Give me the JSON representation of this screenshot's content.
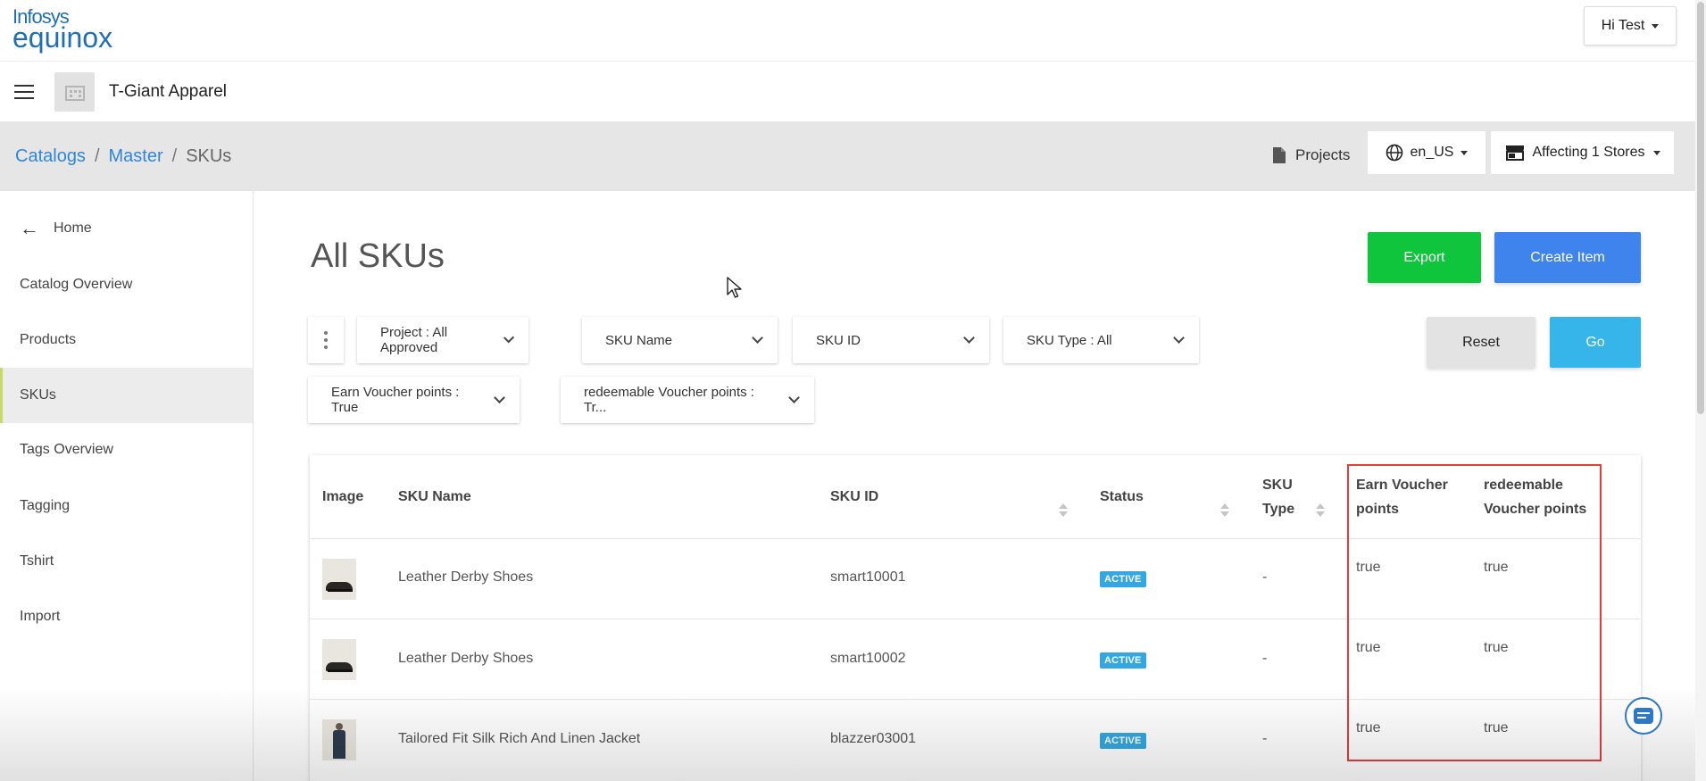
{
  "app": {
    "logo_line1": "Infosys",
    "logo_line2": "equinox",
    "user_menu": "Hi Test",
    "store_name": "T-Giant Apparel"
  },
  "breadcrumb": {
    "items": [
      "Catalogs",
      "Master",
      "SKUs"
    ]
  },
  "toolbar": {
    "projects_label": "Projects",
    "locale_label": "en_US",
    "stores_label": "Affecting 1 Stores"
  },
  "sidebar": {
    "home_label": "Home",
    "items": [
      {
        "label": "Catalog Overview"
      },
      {
        "label": "Products"
      },
      {
        "label": "SKUs",
        "active": true
      },
      {
        "label": "Tags Overview"
      },
      {
        "label": "Tagging"
      },
      {
        "label": "Tshirt"
      },
      {
        "label": "Import"
      }
    ]
  },
  "main": {
    "title": "All SKUs",
    "export_label": "Export",
    "create_label": "Create Item",
    "reset_label": "Reset",
    "go_label": "Go",
    "filters": [
      {
        "label": "Project : All Approved"
      },
      {
        "label": "SKU Name"
      },
      {
        "label": "SKU ID"
      },
      {
        "label": "SKU Type : All"
      },
      {
        "label": "Earn Voucher points : True"
      },
      {
        "label": "redeemable Voucher points : Tr..."
      }
    ]
  },
  "table": {
    "headers": {
      "image": "Image",
      "sku_name": "SKU Name",
      "sku_id": "SKU ID",
      "status": "Status",
      "sku_type_1": "SKU",
      "sku_type_2": "Type",
      "earn_1": "Earn Voucher",
      "earn_2": "points",
      "redeem_1": "redeemable",
      "redeem_2": "Voucher points"
    },
    "rows": [
      {
        "image": "shoe-icon",
        "sku_name": "Leather Derby Shoes",
        "sku_id": "smart10001",
        "status": "ACTIVE",
        "sku_type": "-",
        "earn": "true",
        "redeem": "true"
      },
      {
        "image": "shoe-icon",
        "sku_name": "Leather Derby Shoes",
        "sku_id": "smart10002",
        "status": "ACTIVE",
        "sku_type": "-",
        "earn": "true",
        "redeem": "true"
      },
      {
        "image": "jacket-icon",
        "sku_name": "Tailored Fit Silk Rich And Linen Jacket",
        "sku_id": "blazzer03001",
        "status": "ACTIVE",
        "sku_type": "-",
        "earn": "true",
        "redeem": "true"
      }
    ]
  },
  "colors": {
    "export": "#0ec53c",
    "create": "#3f84ec",
    "go": "#35b5ea",
    "badge": "#33a8e0",
    "highlight": "#e33c3c",
    "link": "#2f86d8"
  }
}
